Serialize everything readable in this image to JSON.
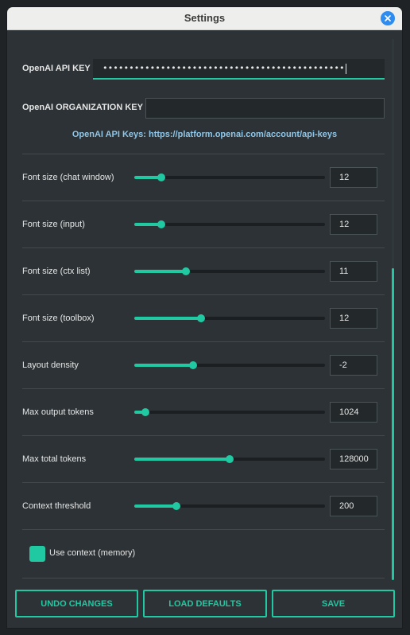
{
  "window": {
    "title": "Settings",
    "close_icon": "close-icon"
  },
  "api_key": {
    "label": "OpenAI API KEY",
    "value": "••••••••••••••••••••••••••••••••••••••••••••••"
  },
  "org_key": {
    "label": "OpenAI ORGANIZATION KEY",
    "value": ""
  },
  "link": {
    "text": "OpenAI API Keys: https://platform.openai.com/account/api-keys"
  },
  "settings": [
    {
      "label": "Font size (chat window)",
      "value": "12",
      "fraction": 0.14
    },
    {
      "label": "Font size (input)",
      "value": "12",
      "fraction": 0.14
    },
    {
      "label": "Font size (ctx list)",
      "value": "11",
      "fraction": 0.27
    },
    {
      "label": "Font size (toolbox)",
      "value": "12",
      "fraction": 0.35
    },
    {
      "label": "Layout density",
      "value": "-2",
      "fraction": 0.31
    },
    {
      "label": "Max output tokens",
      "value": "1024",
      "fraction": 0.06
    },
    {
      "label": "Max total tokens",
      "value": "128000",
      "fraction": 0.5
    },
    {
      "label": "Context threshold",
      "value": "200",
      "fraction": 0.22
    }
  ],
  "use_context": {
    "label": "Use context (memory)",
    "checked": true
  },
  "buttons": {
    "undo": "UNDO CHANGES",
    "defaults": "LOAD DEFAULTS",
    "save": "SAVE"
  },
  "colors": {
    "accent": "#20c9a2",
    "background": "#2c3235",
    "close_button": "#2e8cf0"
  }
}
